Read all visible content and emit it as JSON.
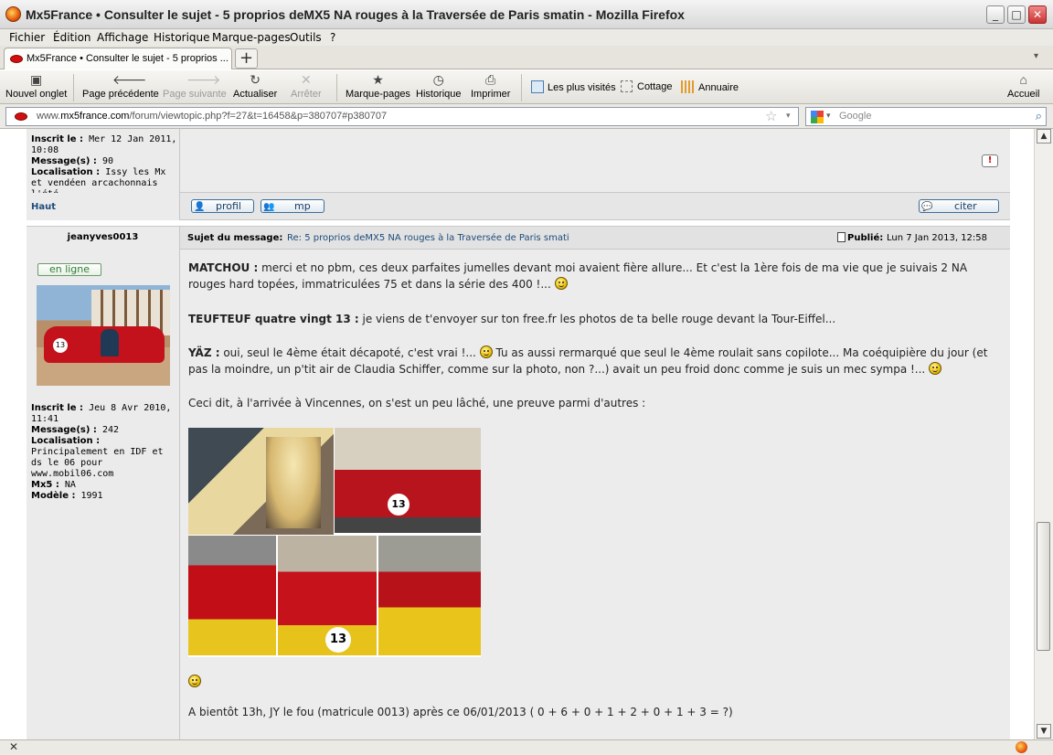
{
  "window": {
    "title": "Mx5France • Consulter le sujet - 5 proprios deMX5 NA rouges à la Traversée de Paris smatin - Mozilla Firefox",
    "controls": {
      "minimize": "_",
      "maximize": "□",
      "close": "✕"
    }
  },
  "menu": [
    "Fichier",
    "Édition",
    "Affichage",
    "Historique",
    "Marque-pages",
    "Outils",
    "?"
  ],
  "tabs": [
    {
      "label": "Mx5France • Consulter le sujet - 5 proprios ...",
      "close": "×"
    }
  ],
  "new_tab": "+",
  "toolbar": {
    "new_tab": "Nouvel onglet",
    "back": "Page précédente",
    "forward": "Page suivante",
    "reload": "Actualiser",
    "stop": "Arrêter",
    "bookmarks": "Marque-pages",
    "history": "Historique",
    "print": "Imprimer",
    "most_visited": "Les plus visités",
    "cottage": "Cottage",
    "annuaire": "Annuaire",
    "home": "Accueil"
  },
  "url": {
    "prefix": "www.",
    "domain": "mx5france.com",
    "path": "/forum/viewtopic.php?f=27&t=16458&p=380707#p380707"
  },
  "search": {
    "placeholder": "Google"
  },
  "prev_post": {
    "profile": {
      "inscrit_label": "Inscrit le :",
      "inscrit_value": "Mer 12 Jan 2011, 10:08",
      "messages_label": "Message(s) :",
      "messages_value": "90",
      "loc_label": "Localisation :",
      "loc_value": "Issy les Mx et vendéen arcachonnais l'été"
    },
    "haut": "Haut",
    "buttons": {
      "profil": "profil",
      "mp": "mp",
      "citer": "citer"
    }
  },
  "post": {
    "author": "jeanyves0013",
    "subject_label": "Sujet du message:",
    "subject": "Re: 5 proprios deMX5 NA rouges à la Traversée de Paris smati",
    "published_label": "Publié:",
    "published": "Lun 7 Jan 2013, 12:58",
    "online": "en ligne",
    "profile": {
      "inscrit_label": "Inscrit le :",
      "inscrit_value": "Jeu 8 Avr 2010, 11:41",
      "messages_label": "Message(s) :",
      "messages_value": "242",
      "loc_label": "Localisation :",
      "loc_value": "Principalement en IDF et ds le 06 pour www.mobil06.com",
      "mx5_label": "Mx5 :",
      "mx5_value": "NA",
      "modele_label": "Modèle :",
      "modele_value": "1991"
    },
    "paragraphs": {
      "p1_name": "MATCHOU :",
      "p1_text": " merci et no pbm, ces deux parfaites jumelles devant moi avaient fière allure... Et c'est la 1ère fois de ma vie que je suivais 2 NA rouges hard topées, immatriculées 75 et dans la série des 400 !...",
      "p2_name": "TEUFTEUF quatre vingt 13 :",
      "p2_text": " je viens de t'envoyer sur ton free.fr les photos de ta belle rouge devant la Tour-Eiffel...",
      "p3_name": "YÄZ :",
      "p3_text_a": " oui, seul le 4ème était décapoté, c'est vrai !...",
      "p3_text_b": " Tu as aussi rermarqué que seul le 4ème roulait sans copilote... Ma coéquipière du jour (et pas la moindre, un p'tit air de Claudia Schiffer, comme sur la photo, non ?...) avait un peu froid donc comme je suis un mec sympa !...",
      "p4": "Ceci dit, à l'arrivée à Vincennes, on s'est un peu lâché, une preuve parmi d'autres :",
      "p5": "A bientôt 13h, JY le fou (matricule 0013) après ce 06/01/2013 ( 0 + 6 + 0 + 1 + 2 + 0 + 1 + 3 = ?)"
    },
    "car_number": "13"
  },
  "colors": {
    "link": "#1d4b7a",
    "online": "#2e7d32",
    "accent": "#ececec"
  }
}
